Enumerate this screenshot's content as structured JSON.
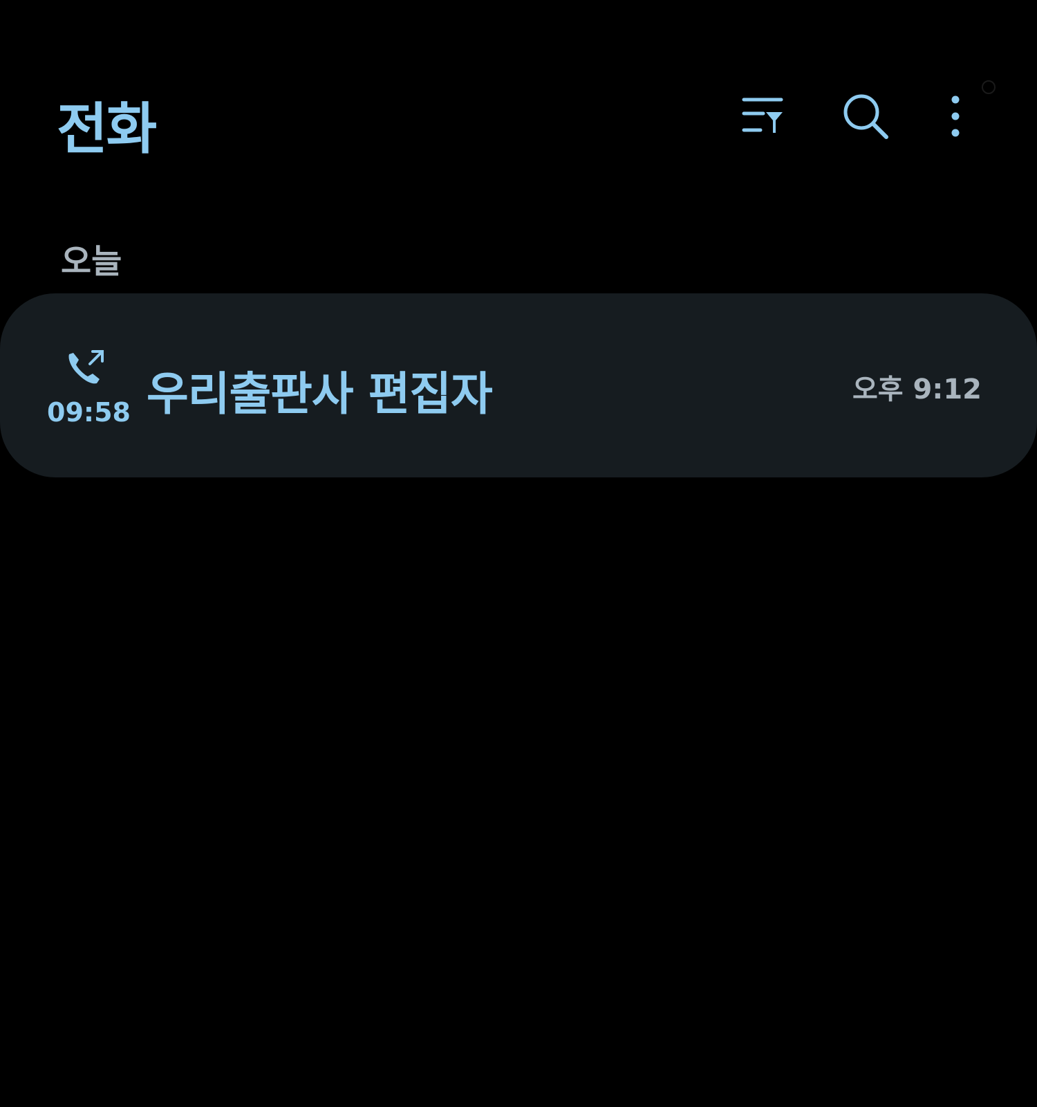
{
  "header": {
    "title": "전화",
    "icons": [
      "filter-icon",
      "search-icon",
      "more-vert-icon"
    ]
  },
  "section": {
    "label": "오늘"
  },
  "call_log": [
    {
      "name": "우리출판사 편집자",
      "duration": "09:58",
      "time": "오후 9:12",
      "type": "outgoing-call-icon"
    }
  ],
  "colors": {
    "accent": "#8ecbf0",
    "secondary": "#a9b4bd",
    "card": "#161c20",
    "background": "#000000"
  }
}
